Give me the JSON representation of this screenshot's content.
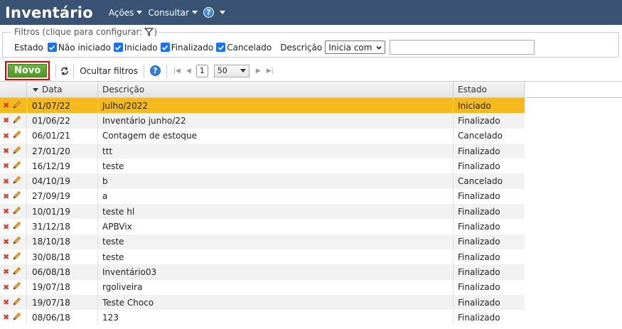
{
  "app": {
    "title": "Inventário"
  },
  "menu": {
    "acoes": "Ações",
    "consultar": "Consultar",
    "help": "?"
  },
  "filters": {
    "legend": "Filtros (clique para configurar:",
    "legend_close": ")",
    "estado_label": "Estado",
    "options": [
      {
        "label": "Não iniciado",
        "checked": true
      },
      {
        "label": "Iniciado",
        "checked": true
      },
      {
        "label": "Finalizado",
        "checked": true
      },
      {
        "label": "Cancelado",
        "checked": true
      }
    ],
    "descricao_label": "Descrição",
    "match_mode": "Inicia com",
    "descricao_value": ""
  },
  "toolbar": {
    "novo": "Novo",
    "ocultar": "Ocultar filtros",
    "help": "?",
    "page": "1",
    "page_size": "50"
  },
  "columns": {
    "date": "Data",
    "desc": "Descrição",
    "state": "Estado"
  },
  "rows": [
    {
      "date": "01/07/22",
      "desc": "Julho/2022",
      "state": "Iniciado",
      "selected": true
    },
    {
      "date": "01/06/22",
      "desc": "Inventário junho/22",
      "state": "Finalizado"
    },
    {
      "date": "06/01/21",
      "desc": "Contagem de estoque",
      "state": "Cancelado"
    },
    {
      "date": "27/01/20",
      "desc": "ttt",
      "state": "Finalizado"
    },
    {
      "date": "16/12/19",
      "desc": "teste",
      "state": "Finalizado"
    },
    {
      "date": "04/10/19",
      "desc": "b",
      "state": "Cancelado"
    },
    {
      "date": "27/09/19",
      "desc": "a",
      "state": "Finalizado"
    },
    {
      "date": "10/01/19",
      "desc": "teste hl",
      "state": "Finalizado"
    },
    {
      "date": "31/12/18",
      "desc": "APBVix",
      "state": "Finalizado"
    },
    {
      "date": "18/10/18",
      "desc": "teste",
      "state": "Finalizado"
    },
    {
      "date": "30/08/18",
      "desc": "teste",
      "state": "Finalizado"
    },
    {
      "date": "06/08/18",
      "desc": "Inventário03",
      "state": "Finalizado"
    },
    {
      "date": "19/07/18",
      "desc": "rgoliveira",
      "state": "Finalizado"
    },
    {
      "date": "19/07/18",
      "desc": "Teste Choco",
      "state": "Finalizado"
    },
    {
      "date": "08/06/18",
      "desc": "123",
      "state": "Finalizado"
    }
  ],
  "colors": {
    "header_bg": "#3a5273",
    "selected_row": "#f5b91c",
    "novo_green": "#5aa52d",
    "delete_red": "#d63b28",
    "checkbox_blue": "#1a73e8"
  },
  "icons": {
    "delete": "close-icon",
    "edit": "pencil-icon",
    "filter": "filter-icon",
    "refresh": "refresh-icon"
  }
}
